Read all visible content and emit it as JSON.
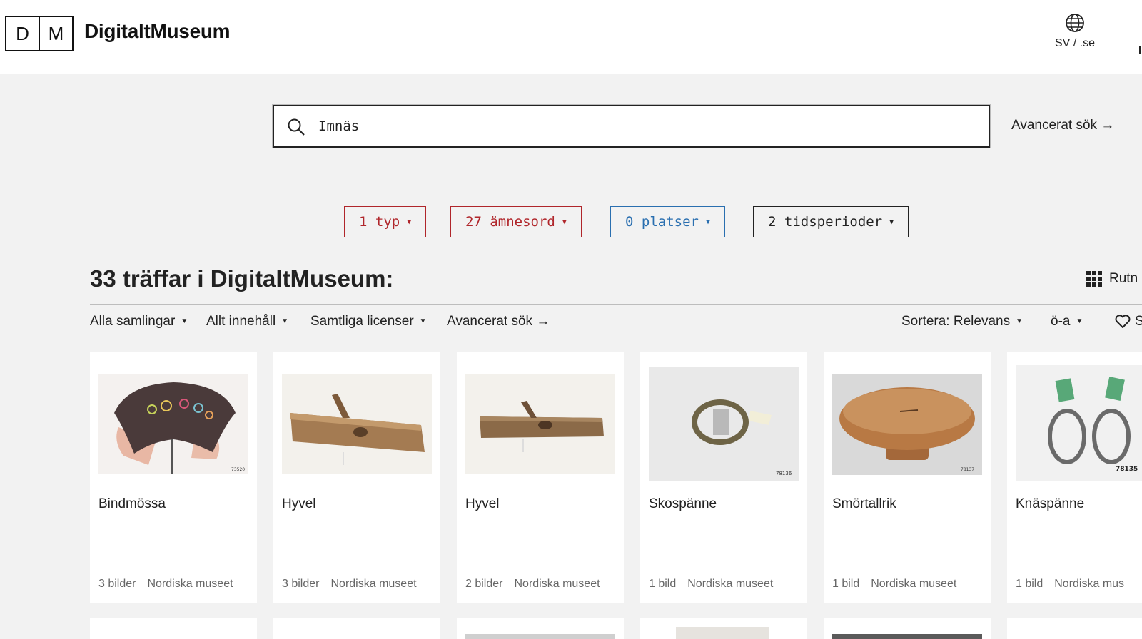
{
  "header": {
    "logo_letters": [
      "D",
      "M"
    ],
    "brand": "DigitaltMuseum",
    "lang_label": "SV / .se"
  },
  "search": {
    "value": "Imnäs",
    "advanced_label": "Avancerat sök →"
  },
  "filters": [
    {
      "label": "1 typ",
      "color": "#b0262b"
    },
    {
      "label": "27 ämnesord",
      "color": "#b0262b"
    },
    {
      "label": "0 platser",
      "color": "#2a6fb0"
    },
    {
      "label": "2 tidsperioder",
      "color": "#222222"
    }
  ],
  "results": {
    "title": "33 träffar i DigitaltMuseum:",
    "view_label": "Rutn"
  },
  "toolbar": {
    "collections": "Alla samlingar",
    "content": "Allt innehåll",
    "licenses": "Samtliga licenser",
    "advanced": "Avancerat sök →",
    "sort": "Sortera: Relevans",
    "order": "ö-a",
    "save": "S"
  },
  "cards": [
    {
      "title": "Bindmössa",
      "images": "3 bilder",
      "museum": "Nordiska museet",
      "number": "73520"
    },
    {
      "title": "Hyvel",
      "images": "3 bilder",
      "museum": "Nordiska museet",
      "number": ""
    },
    {
      "title": "Hyvel",
      "images": "2 bilder",
      "museum": "Nordiska museet",
      "number": ""
    },
    {
      "title": "Skospänne",
      "images": "1 bild",
      "museum": "Nordiska museet",
      "number": "78136"
    },
    {
      "title": "Smörtallrik",
      "images": "1 bild",
      "museum": "Nordiska museet",
      "number": "78137"
    },
    {
      "title": "Knäspänne",
      "images": "1 bild",
      "museum": "Nordiska mus",
      "number": "78135"
    }
  ]
}
